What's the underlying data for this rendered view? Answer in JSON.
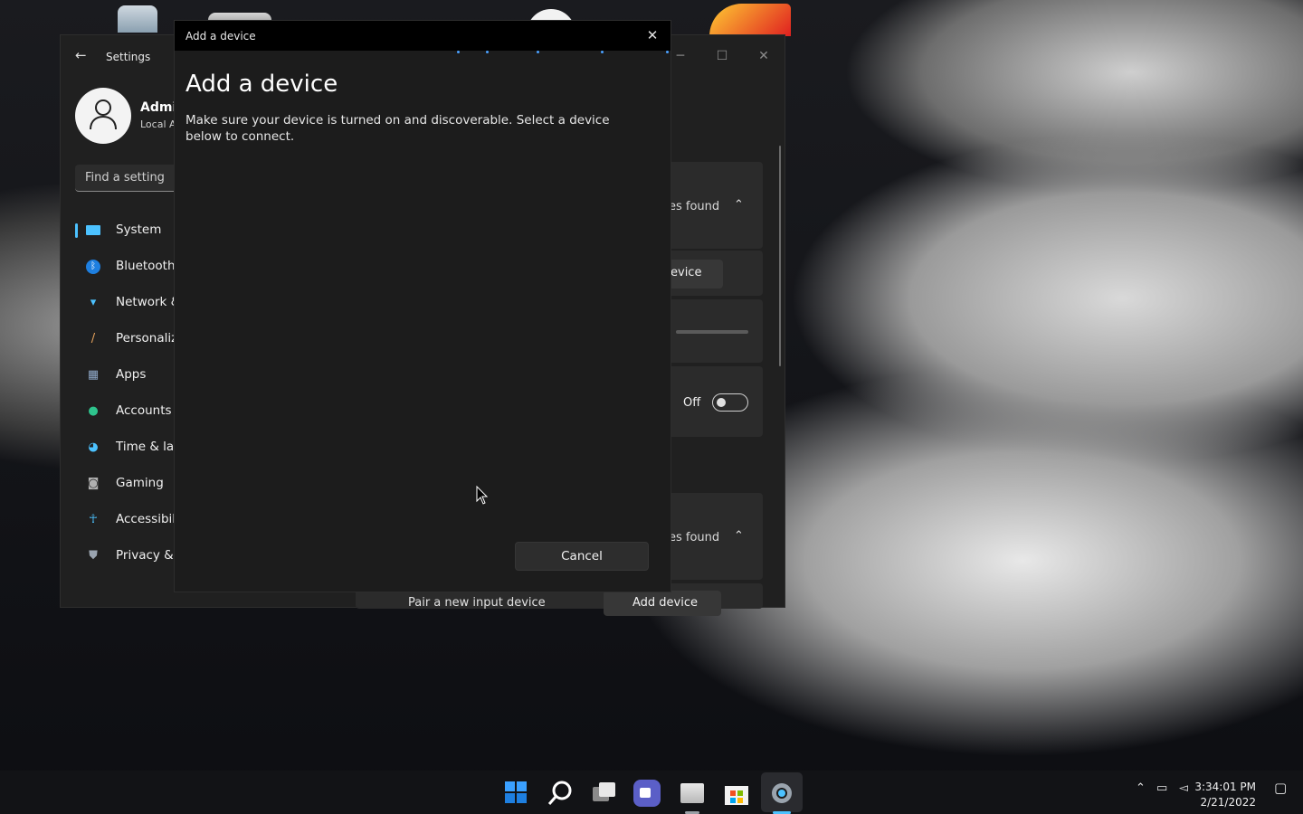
{
  "settings": {
    "title": "Settings",
    "user": {
      "name": "Admir",
      "account": "Local A"
    },
    "search_placeholder": "Find a setting",
    "nav": [
      {
        "label": "System",
        "icon": "system-icon",
        "color": "#4cc2ff"
      },
      {
        "label": "Bluetooth",
        "icon": "bluetooth-icon",
        "color": "#1e90ff"
      },
      {
        "label": "Network &",
        "icon": "wifi-icon",
        "color": "#4cc2ff"
      },
      {
        "label": "Personaliz",
        "icon": "brush-icon",
        "color": "#e6a35c"
      },
      {
        "label": "Apps",
        "icon": "apps-icon",
        "color": "#8fa8c8"
      },
      {
        "label": "Accounts",
        "icon": "person-icon",
        "color": "#2ec48d"
      },
      {
        "label": "Time & lan",
        "icon": "globe-icon",
        "color": "#4cc2ff"
      },
      {
        "label": "Gaming",
        "icon": "gamepad-icon",
        "color": "#b0b0b0"
      },
      {
        "label": "Accessibili",
        "icon": "accessibility-icon",
        "color": "#4cc2ff"
      },
      {
        "label": "Privacy & s",
        "icon": "shield-icon",
        "color": "#9aa4b0"
      }
    ],
    "content": {
      "devices_found_1": "es found",
      "add_device_partial": "evice",
      "toggle_label": "Off",
      "devices_found_2": "es found",
      "pair_input": "Pair a new input device",
      "add_device": "Add device"
    }
  },
  "dialog": {
    "window_title": "Add a device",
    "heading": "Add a device",
    "description": "Make sure your device is turned on and discoverable. Select a device below to connect.",
    "cancel_label": "Cancel"
  },
  "taskbar": {
    "apps": [
      "start-icon",
      "search-icon",
      "task-view-icon",
      "chat-icon",
      "file-explorer-icon",
      "store-icon",
      "settings-icon"
    ],
    "time": "3:34:01 PM",
    "date": "2/21/2022"
  }
}
